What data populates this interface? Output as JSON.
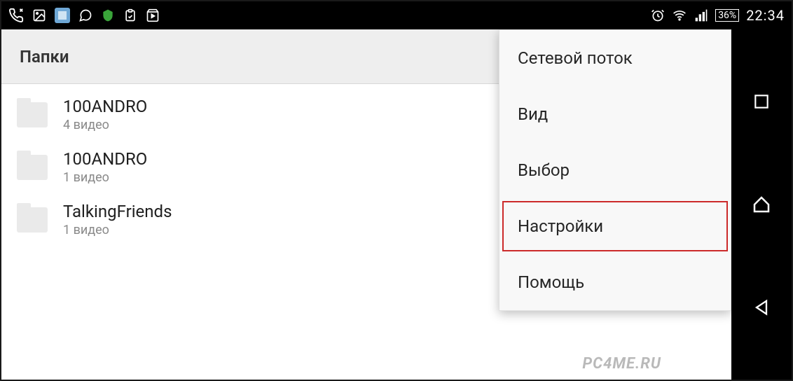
{
  "statusbar": {
    "battery_text": "36%",
    "clock": "22:34"
  },
  "header": {
    "title": "Папки"
  },
  "folders": [
    {
      "name": "100ANDRO",
      "sub": "4 видео"
    },
    {
      "name": "100ANDRO",
      "sub": "1 видео"
    },
    {
      "name": "TalkingFriends",
      "sub": "1 видео"
    }
  ],
  "menu": {
    "items": [
      {
        "label": "Сетевой поток",
        "highlight": false
      },
      {
        "label": "Вид",
        "highlight": false
      },
      {
        "label": "Выбор",
        "highlight": false
      },
      {
        "label": "Настройки",
        "highlight": true
      },
      {
        "label": "Помощь",
        "highlight": false
      }
    ]
  },
  "watermark": "PC4ME.RU"
}
